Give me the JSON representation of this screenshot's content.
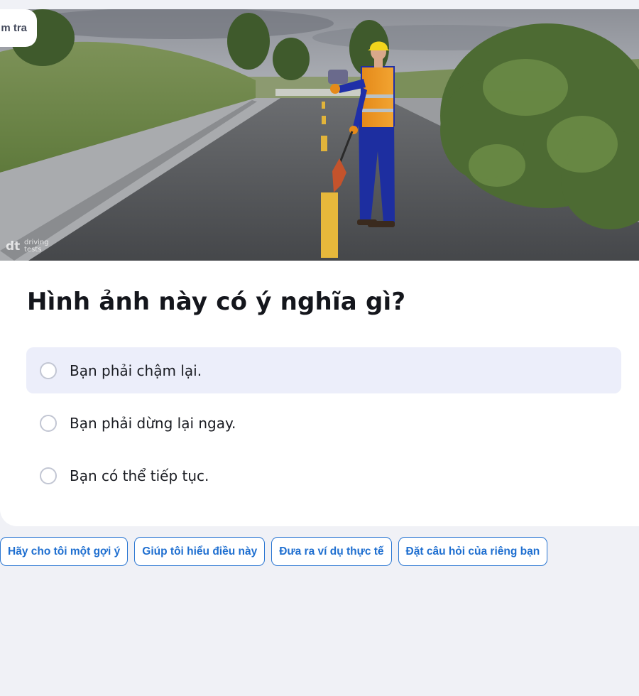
{
  "header": {
    "tag_label": "m tra"
  },
  "image": {
    "watermark_logo": "dt",
    "watermark_text": "driving tests"
  },
  "question": {
    "title": "Hình ảnh này có ý nghĩa gì?",
    "options": [
      {
        "label": "Bạn phải chậm lại."
      },
      {
        "label": "Bạn phải dừng lại ngay."
      },
      {
        "label": "Bạn có thể tiếp tục."
      }
    ]
  },
  "suggestions": [
    {
      "label": "Hãy cho tôi một gợi ý"
    },
    {
      "label": "Giúp tôi hiểu điều này"
    },
    {
      "label": "Đưa ra ví dụ thực tế"
    },
    {
      "label": "Đặt câu hỏi của riêng bạn"
    }
  ],
  "colors": {
    "page_bg": "#f0f1f6",
    "accent": "#1f6fd0",
    "hover_option_bg": "#eceefa"
  }
}
